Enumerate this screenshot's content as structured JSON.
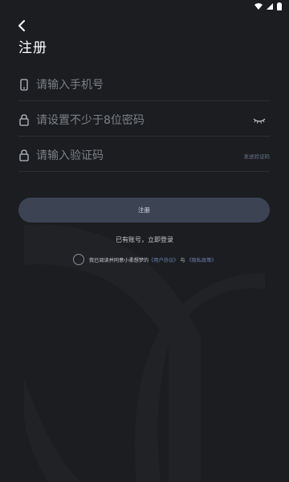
{
  "colors": {
    "background": "#1b1d20",
    "button": "#3c4454",
    "link": "#6d7fae"
  },
  "status_bar": {
    "icons": [
      "wifi-icon",
      "signal-icon",
      "battery-icon"
    ]
  },
  "header": {
    "back_icon": "chevron-left-icon",
    "title": "注册"
  },
  "form": {
    "phone": {
      "icon": "phone-icon",
      "placeholder": "请输入手机号",
      "value": ""
    },
    "password": {
      "icon": "lock-icon",
      "placeholder": "请设置不少于8位密码",
      "value": "",
      "toggle_icon": "eye-closed-icon"
    },
    "code": {
      "icon": "lock-icon",
      "placeholder": "请输入验证码",
      "value": "",
      "send_label": "发送验证码"
    }
  },
  "actions": {
    "register_label": "注册",
    "login_link": "已有账号，立即登录"
  },
  "agreement": {
    "checked": false,
    "prefix": "我已阅读并同意小柔想梦的",
    "user_agreement": "《用户协议》",
    "conjunction": "与",
    "privacy_policy": "《隐私政策》"
  }
}
